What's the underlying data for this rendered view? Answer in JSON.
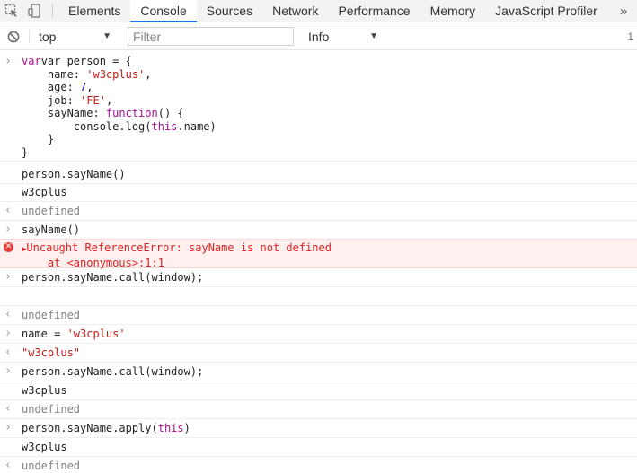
{
  "toolbar": {
    "tabs": [
      "Elements",
      "Console",
      "Sources",
      "Network",
      "Performance",
      "Memory",
      "JavaScript Profiler"
    ],
    "active_tab": "Console",
    "overflow_icon": "double-chevron-right-icon"
  },
  "filterbar": {
    "context": "top",
    "filter_placeholder": "Filter",
    "level": "Info",
    "count": "1"
  },
  "console": {
    "block1": {
      "l1": "var person = {",
      "name_key": "    name: ",
      "name_val": "'w3cplus'",
      "age_key": "    age: ",
      "age_val": "7",
      "job_key": "    job: ",
      "job_val": "'FE'",
      "say_key": "    sayName: ",
      "say_fn": "function",
      "say_rest": "() {",
      "log_pre": "        console.log(",
      "log_this": "this",
      "log_post": ".name)",
      "close_inner": "    }",
      "close_outer": "}"
    },
    "cmd_sayname_call": "person.sayName()",
    "out_w3cplus_1": "w3cplus",
    "ret_undefined_1": "undefined",
    "cmd_sayname": "sayName()",
    "error_line1": "Uncaught ReferenceError: sayName is not defined",
    "error_line2": "    at <anonymous>:1:1",
    "cmd_call_window_1": "person.sayName.call(window);",
    "ret_undefined_2": "undefined",
    "cmd_name_assign_pre": "name = ",
    "cmd_name_assign_val": "'w3cplus'",
    "ret_w3cplus_str": "\"w3cplus\"",
    "cmd_call_window_2": "person.sayName.call(window);",
    "out_w3cplus_2": "w3cplus",
    "ret_undefined_3": "undefined",
    "cmd_apply_pre": "person.sayName.apply(",
    "cmd_apply_this": "this",
    "cmd_apply_post": ")",
    "out_w3cplus_3": "w3cplus",
    "ret_undefined_4": "undefined"
  }
}
